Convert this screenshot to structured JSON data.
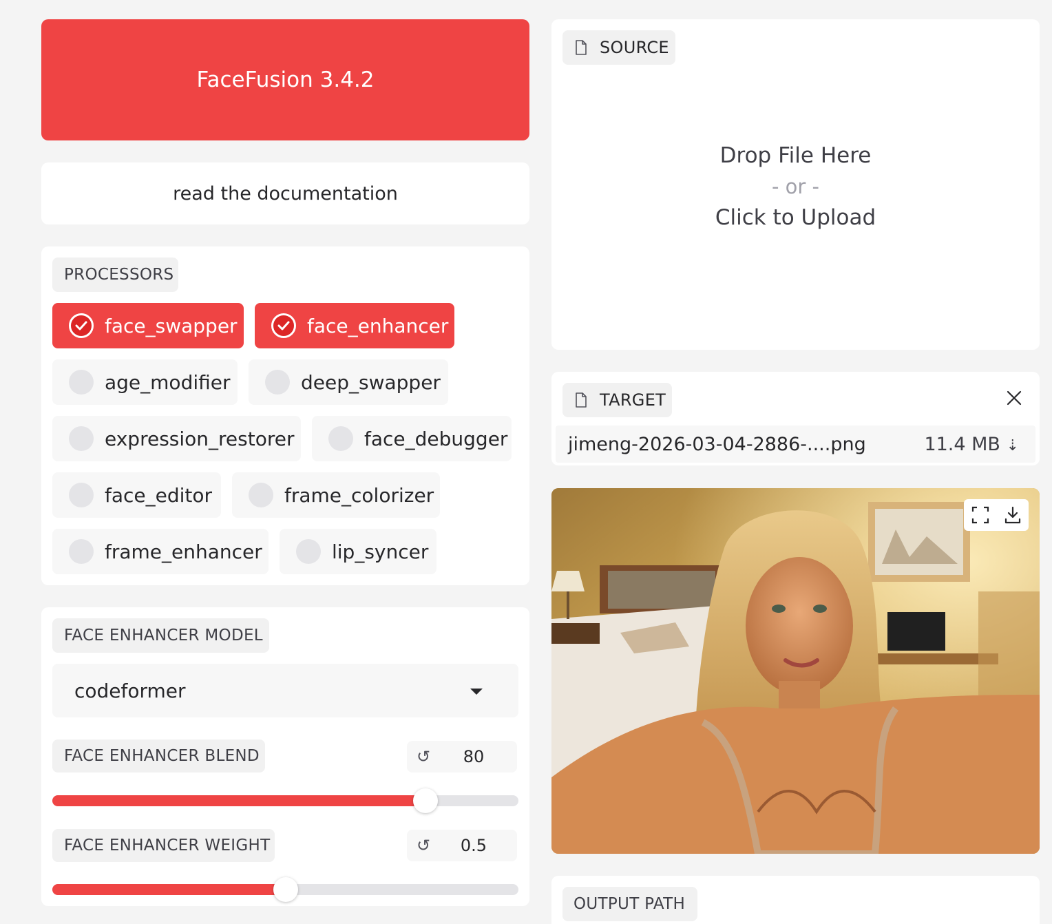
{
  "header": {
    "title": "FaceFusion 3.4.2",
    "docs_link": "read the documentation"
  },
  "processors": {
    "label": "PROCESSORS",
    "items": [
      {
        "label": "face_swapper",
        "checked": true
      },
      {
        "label": "face_enhancer",
        "checked": true
      },
      {
        "label": "age_modifier",
        "checked": false
      },
      {
        "label": "deep_swapper",
        "checked": false
      },
      {
        "label": "expression_restorer",
        "checked": false
      },
      {
        "label": "face_debugger",
        "checked": false
      },
      {
        "label": "face_editor",
        "checked": false
      },
      {
        "label": "frame_colorizer",
        "checked": false
      },
      {
        "label": "frame_enhancer",
        "checked": false
      },
      {
        "label": "lip_syncer",
        "checked": false
      }
    ]
  },
  "face_enhancer": {
    "model_label": "FACE ENHANCER MODEL",
    "model_value": "codeformer",
    "blend_label": "FACE ENHANCER BLEND",
    "blend_value": "80",
    "blend_fraction": 0.8,
    "weight_label": "FACE ENHANCER WEIGHT",
    "weight_value": "0.5",
    "weight_fraction": 0.5
  },
  "source": {
    "label": "SOURCE",
    "drop_text": "Drop File Here",
    "or_text": "- or -",
    "upload_text": "Click to Upload"
  },
  "target": {
    "label": "TARGET",
    "file_name": "jimeng-2026-03-04-2886-....png",
    "file_size": "11.4 MB",
    "download_glyph": "⇣"
  },
  "output": {
    "label": "OUTPUT PATH"
  },
  "colors": {
    "accent": "#ef4444",
    "background": "#f4f4f4",
    "card": "#ffffff"
  },
  "icons": [
    "file-icon",
    "close-icon",
    "check-icon",
    "reset-icon",
    "caret-down-icon",
    "fullscreen-icon",
    "download-icon"
  ]
}
